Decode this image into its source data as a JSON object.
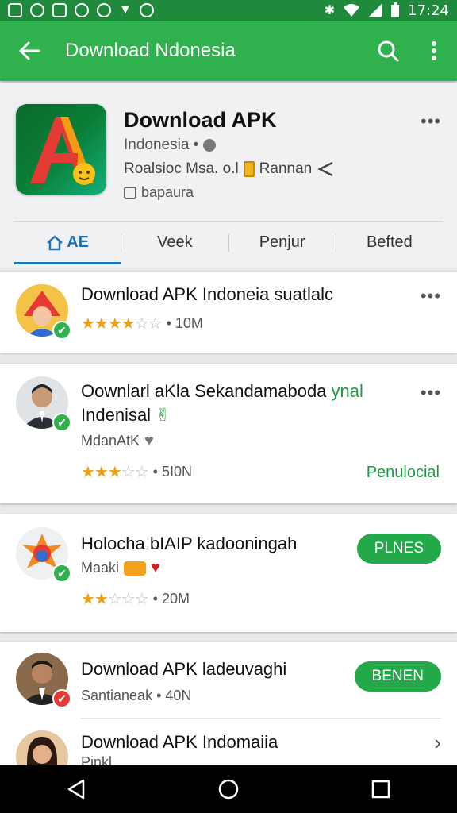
{
  "status_bar": {
    "time": "17:24"
  },
  "app_bar": {
    "title": "Download Ndonesia"
  },
  "header": {
    "app_name": "Download APK",
    "meta1": "Indonesia •",
    "meta2_a": "Roalsioc Msa. o.l",
    "meta2_b": "Rannan",
    "meta3": "bapaura"
  },
  "tabs": [
    {
      "label": "AE"
    },
    {
      "label": "Veek"
    },
    {
      "label": "Penjur"
    },
    {
      "label": "Befted"
    }
  ],
  "items": [
    {
      "title": "Download APK Indoneia suatlalc",
      "rating": 4.5,
      "installs": "• 10M"
    },
    {
      "title_line1": "Oownlarl aKla Sekandamaboda",
      "title_green": "ynal",
      "title_line2": "Indenisal",
      "sub": "MdanAtK",
      "rating": 3.5,
      "installs": "• 5I0N",
      "action_text": "Penulocial"
    },
    {
      "title": "Holocha bIAIP kadooningah",
      "sub": "Maaki",
      "rating": 2.5,
      "installs": "• 20M",
      "action_button": "PLNES"
    },
    {
      "title": "Download APK ladeuvaghi",
      "sub": "Santianeak • 40N",
      "action_button": "BENEN"
    },
    {
      "title": "Download APK Indomaiia",
      "sub": "Pinkl"
    }
  ],
  "colors": {
    "app_bar": "#2fb14e",
    "status_bar": "#1f8a3c",
    "accent_tab": "#1a73b8",
    "button_green": "#23a94a",
    "star": "#e8a21a"
  }
}
